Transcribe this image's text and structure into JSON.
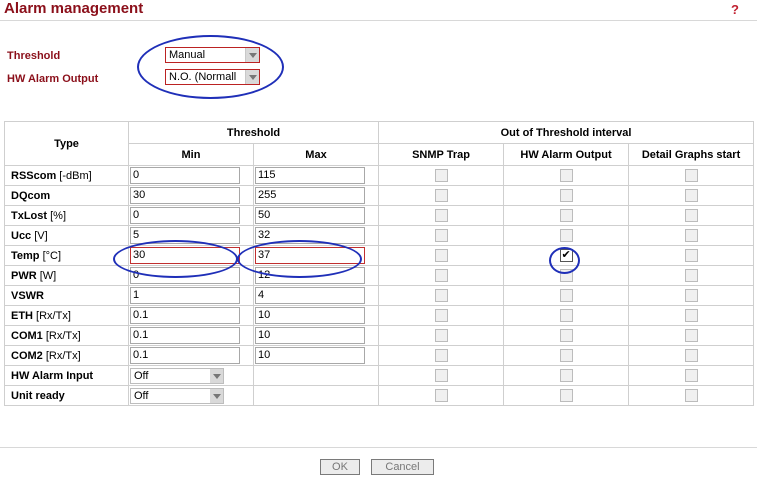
{
  "header": {
    "title": "Alarm management",
    "help": "?"
  },
  "settings": {
    "threshold": {
      "label": "Threshold",
      "value": "Manual"
    },
    "hw_alarm_output": {
      "label": "HW Alarm Output",
      "value": "N.O. (Normall"
    }
  },
  "table": {
    "headers": {
      "type": "Type",
      "threshold": "Threshold",
      "out_of_threshold": "Out of Threshold interval",
      "min": "Min",
      "max": "Max",
      "snmp_trap": "SNMP Trap",
      "hw_alarm_output": "HW Alarm Output",
      "detail_graphs": "Detail Graphs start"
    },
    "rows": [
      {
        "name": "RSScom",
        "unit": " [-dBm]",
        "min": "0",
        "max": "115",
        "hw": false
      },
      {
        "name": "DQcom",
        "unit": "",
        "min": "30",
        "max": "255",
        "hw": false
      },
      {
        "name": "TxLost",
        "unit": " [%]",
        "min": "0",
        "max": "50",
        "hw": false
      },
      {
        "name": "Ucc",
        "unit": " [V]",
        "min": "5",
        "max": "32",
        "hw": false
      },
      {
        "name": "Temp",
        "unit": " [°C]",
        "min": "30",
        "max": "37",
        "hw": true
      },
      {
        "name": "PWR",
        "unit": " [W]",
        "min": "0",
        "max": "12",
        "hw": false
      },
      {
        "name": "VSWR",
        "unit": "",
        "min": "1",
        "max": "4",
        "hw": false
      },
      {
        "name": "ETH",
        "unit": " [Rx/Tx]",
        "min": "0.1",
        "max": "10",
        "hw": false
      },
      {
        "name": "COM1",
        "unit": " [Rx/Tx]",
        "min": "0.1",
        "max": "10",
        "hw": false
      },
      {
        "name": "COM2",
        "unit": " [Rx/Tx]",
        "min": "0.1",
        "max": "10",
        "hw": false
      }
    ],
    "select_rows": [
      {
        "name": "HW Alarm Input",
        "value": "Off"
      },
      {
        "name": "Unit ready",
        "value": "Off"
      }
    ]
  },
  "buttons": {
    "ok": "OK",
    "cancel": "Cancel"
  },
  "colors": {
    "title": "#8b0f1a",
    "annotation": "#1f2fb8",
    "highlight_border": "#c03030"
  }
}
